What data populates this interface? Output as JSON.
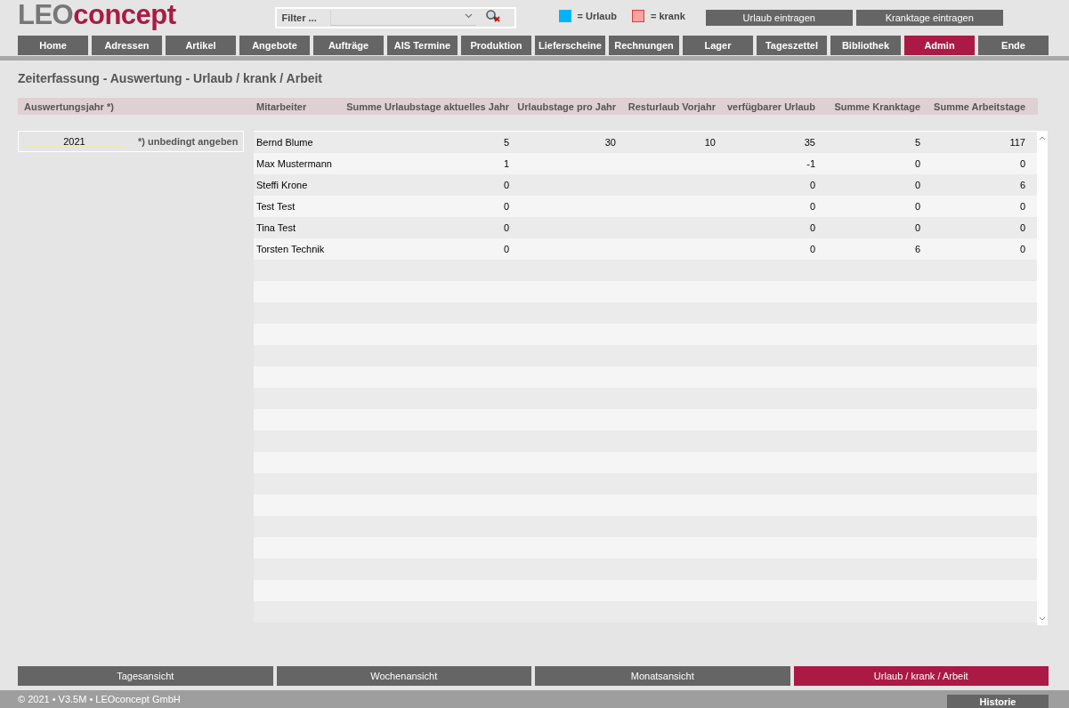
{
  "logo": {
    "prefix": "LEO",
    "suffix": "concept"
  },
  "filter": {
    "label": "Filter ..."
  },
  "legend": [
    {
      "label": "= Urlaub",
      "color": "#00b4ff"
    },
    {
      "label": "= krank",
      "color": "#f7a3a3"
    }
  ],
  "header_buttons": [
    "Urlaub eintragen",
    "Kranktage eintragen"
  ],
  "nav_tabs": [
    {
      "label": "Home",
      "selected": false
    },
    {
      "label": "Adressen",
      "selected": false
    },
    {
      "label": "Artikel",
      "selected": false
    },
    {
      "label": "Angebote",
      "selected": false
    },
    {
      "label": "Aufträge",
      "selected": false
    },
    {
      "label": "AIS Termine",
      "selected": false
    },
    {
      "label": "Produktion",
      "selected": false
    },
    {
      "label": "Lieferscheine",
      "selected": false
    },
    {
      "label": "Rechnungen",
      "selected": false
    },
    {
      "label": "Lager",
      "selected": false
    },
    {
      "label": "Tageszettel",
      "selected": false
    },
    {
      "label": "Bibliothek",
      "selected": false
    },
    {
      "label": "Admin",
      "selected": true
    },
    {
      "label": "Ende",
      "selected": false
    }
  ],
  "page_title": "Zeiterfassung - Auswertung - Urlaub / krank / Arbeit",
  "year_panel": {
    "label": "Auswertungsjahr *)",
    "value": "2021",
    "hint": "*) unbedingt angeben"
  },
  "table": {
    "columns": [
      "Mitarbeiter",
      "Summe Urlaubstage aktuelles Jahr",
      "Urlaubstage pro Jahr",
      "Resturlaub Vorjahr",
      "verfügbarer Urlaub",
      "Summe Kranktage",
      "Summe Arbeitstage"
    ],
    "rows": [
      [
        "Bernd Blume",
        "5",
        "30",
        "10",
        "35",
        "5",
        "117"
      ],
      [
        "Max Mustermann",
        "1",
        "",
        "",
        "-1",
        "0",
        "0"
      ],
      [
        "Steffi Krone",
        "0",
        "",
        "",
        "0",
        "0",
        "6"
      ],
      [
        "Test Test",
        "0",
        "",
        "",
        "0",
        "0",
        "0"
      ],
      [
        "Tina Test",
        "0",
        "",
        "",
        "0",
        "0",
        "0"
      ],
      [
        "Torsten Technik",
        "0",
        "",
        "",
        "0",
        "6",
        "0"
      ]
    ]
  },
  "view_tabs": [
    {
      "label": "Tagesansicht",
      "selected": false
    },
    {
      "label": "Wochenansicht",
      "selected": false
    },
    {
      "label": "Monatsansicht",
      "selected": false
    },
    {
      "label": "Urlaub / krank / Arbeit",
      "selected": true
    }
  ],
  "footer": {
    "copyright": "© 2021 • V3.5M • LEOconcept GmbH",
    "button": "Historie"
  }
}
